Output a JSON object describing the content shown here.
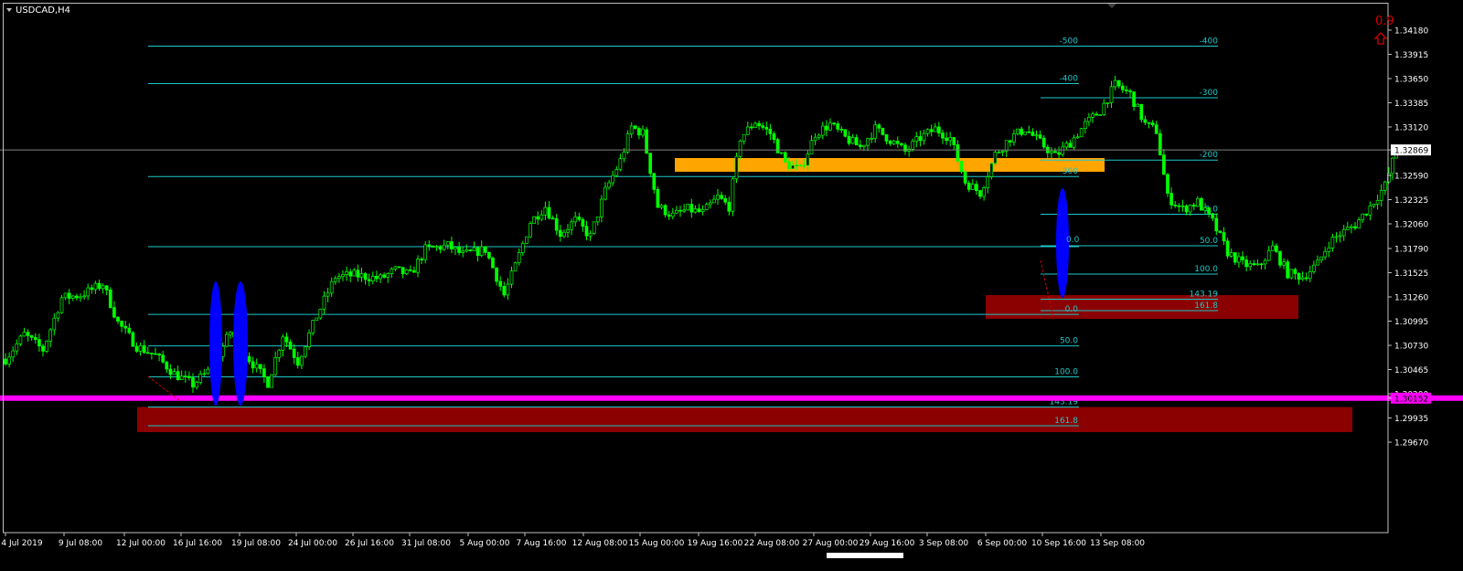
{
  "window": {
    "title": "USDCAD,H4",
    "indicator_value": "0.9"
  },
  "colors": {
    "background": "#000000",
    "frame": "#c0c0c0",
    "candle": "#00ff00",
    "fib": "#1fc8c8",
    "support": "#ff00ff",
    "resistance_zone": "#ffa500",
    "target_zone": "#8b0000",
    "highlight": "#0000ff",
    "current_price_line": "#808080",
    "indicator": "#d00000"
  },
  "chart_data": {
    "type": "candlestick",
    "symbol": "USDCAD",
    "timeframe": "H4",
    "current_price": 1.32869,
    "support_level": 1.30152,
    "ylim": [
      1.2965,
      1.3442
    ],
    "y_ticks": [
      "1.34180",
      "1.33915",
      "1.33650",
      "1.33385",
      "1.33120",
      "1.32869",
      "1.32590",
      "1.32325",
      "1.32060",
      "1.31790",
      "1.31525",
      "1.31260",
      "1.30995",
      "1.30730",
      "1.30465",
      "1.30200",
      "1.30152",
      "1.29935",
      "1.29670"
    ],
    "x_ticks": [
      "4 Jul 2019",
      "9 Jul 08:00",
      "12 Jul 00:00",
      "16 Jul 16:00",
      "19 Jul 08:00",
      "24 Jul 00:00",
      "26 Jul 16:00",
      "31 Jul 08:00",
      "5 Aug 00:00",
      "7 Aug 16:00",
      "12 Aug 08:00",
      "15 Aug 00:00",
      "19 Aug 16:00",
      "22 Aug 08:00",
      "27 Aug 00:00",
      "29 Aug 16:00",
      "3 Sep 08:00",
      "6 Sep 00:00",
      "10 Sep 16:00",
      "13 Sep 08:00"
    ],
    "price_anchors": [
      [
        0,
        1.3058
      ],
      [
        5,
        1.3085
      ],
      [
        10,
        1.3068
      ],
      [
        15,
        1.3125
      ],
      [
        20,
        1.3128
      ],
      [
        26,
        1.314
      ],
      [
        30,
        1.3098
      ],
      [
        35,
        1.3072
      ],
      [
        40,
        1.3062
      ],
      [
        45,
        1.3042
      ],
      [
        50,
        1.303
      ],
      [
        55,
        1.3048
      ],
      [
        60,
        1.3088
      ],
      [
        65,
        1.3058
      ],
      [
        70,
        1.3032
      ],
      [
        74,
        1.3085
      ],
      [
        78,
        1.3055
      ],
      [
        83,
        1.3105
      ],
      [
        88,
        1.3148
      ],
      [
        93,
        1.315
      ],
      [
        100,
        1.3146
      ],
      [
        104,
        1.3155
      ],
      [
        108,
        1.315
      ],
      [
        112,
        1.3178
      ],
      [
        118,
        1.3182
      ],
      [
        122,
        1.3172
      ],
      [
        128,
        1.3178
      ],
      [
        133,
        1.3128
      ],
      [
        136,
        1.316
      ],
      [
        140,
        1.3208
      ],
      [
        144,
        1.3225
      ],
      [
        148,
        1.3195
      ],
      [
        152,
        1.321
      ],
      [
        156,
        1.3192
      ],
      [
        160,
        1.3242
      ],
      [
        164,
        1.3275
      ],
      [
        167,
        1.3312
      ],
      [
        170,
        1.3305
      ],
      [
        174,
        1.3225
      ],
      [
        178,
        1.3215
      ],
      [
        182,
        1.3222
      ],
      [
        186,
        1.3218
      ],
      [
        190,
        1.3235
      ],
      [
        193,
        1.3225
      ],
      [
        196,
        1.33
      ],
      [
        200,
        1.3318
      ],
      [
        204,
        1.3305
      ],
      [
        208,
        1.3272
      ],
      [
        212,
        1.3265
      ],
      [
        216,
        1.3305
      ],
      [
        220,
        1.3315
      ],
      [
        224,
        1.33
      ],
      [
        228,
        1.329
      ],
      [
        232,
        1.331
      ],
      [
        236,
        1.3298
      ],
      [
        240,
        1.3285
      ],
      [
        244,
        1.33
      ],
      [
        248,
        1.331
      ],
      [
        252,
        1.33
      ],
      [
        256,
        1.3252
      ],
      [
        260,
        1.324
      ],
      [
        264,
        1.3282
      ],
      [
        268,
        1.33
      ],
      [
        272,
        1.331
      ],
      [
        276,
        1.3295
      ],
      [
        280,
        1.328
      ],
      [
        284,
        1.3295
      ],
      [
        288,
        1.3315
      ],
      [
        292,
        1.333
      ],
      [
        296,
        1.3358
      ],
      [
        300,
        1.3348
      ],
      [
        304,
        1.3315
      ],
      [
        307,
        1.3308
      ],
      [
        310,
        1.3235
      ],
      [
        314,
        1.3222
      ],
      [
        318,
        1.323
      ],
      [
        322,
        1.3208
      ],
      [
        326,
        1.3175
      ],
      [
        330,
        1.3162
      ],
      [
        334,
        1.3158
      ],
      [
        338,
        1.318
      ],
      [
        342,
        1.3152
      ],
      [
        346,
        1.3148
      ],
      [
        350,
        1.3162
      ],
      [
        353,
        1.3185
      ],
      [
        356,
        1.3195
      ],
      [
        360,
        1.3205
      ],
      [
        364,
        1.3225
      ],
      [
        368,
        1.3248
      ],
      [
        371,
        1.3287
      ]
    ],
    "annotations": {
      "fib_upper": [
        "-500",
        "-400",
        "-300",
        "-200",
        "0.0",
        "50.0",
        "100.0",
        "143.19",
        "161.8"
      ],
      "fib_lower": [
        "-400",
        "-300",
        "0.0",
        "50.0",
        "100.0",
        "143.19",
        "161.8"
      ],
      "support_label": "1.30152",
      "current_price_label": "1.32869",
      "marker_label": "0.0"
    }
  }
}
